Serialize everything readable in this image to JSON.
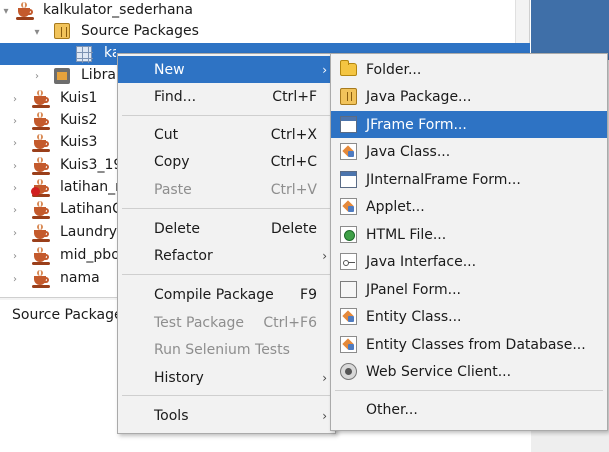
{
  "tree": {
    "items": [
      {
        "label": "kalkulator_sederhana",
        "toggle": "▾"
      },
      {
        "label": "Source Packages",
        "toggle": "▾"
      },
      {
        "label": "kalkulator_sederhana"
      },
      {
        "label": "Libraries",
        "toggle": "›"
      },
      {
        "label": "Kuis1",
        "toggle": "›"
      },
      {
        "label": "Kuis2",
        "toggle": "›"
      },
      {
        "label": "Kuis3",
        "toggle": "›"
      },
      {
        "label": "Kuis3_19",
        "toggle": "›"
      },
      {
        "label": "latihan_m",
        "toggle": "›"
      },
      {
        "label": "LatihanC",
        "toggle": "›"
      },
      {
        "label": "LaundryM",
        "toggle": "›"
      },
      {
        "label": "mid_pbo",
        "toggle": "›"
      },
      {
        "label": "nama",
        "toggle": "›"
      }
    ]
  },
  "navigator": {
    "tab_label": "Source Packages"
  },
  "context_menu": {
    "items": [
      {
        "label": "New",
        "arrow": "›"
      },
      {
        "label": "Find...",
        "shortcut": "Ctrl+F"
      },
      {
        "label": "Cut",
        "shortcut": "Ctrl+X"
      },
      {
        "label": "Copy",
        "shortcut": "Ctrl+C"
      },
      {
        "label": "Paste",
        "shortcut": "Ctrl+V"
      },
      {
        "label": "Delete",
        "shortcut": "Delete"
      },
      {
        "label": "Refactor",
        "arrow": "›"
      },
      {
        "label": "Compile Package",
        "shortcut": "F9"
      },
      {
        "label": "Test Package",
        "shortcut": "Ctrl+F6"
      },
      {
        "label": "Run Selenium Tests"
      },
      {
        "label": "History",
        "arrow": "›"
      },
      {
        "label": "Tools",
        "arrow": "›"
      }
    ]
  },
  "new_submenu": {
    "items": [
      {
        "label": "Folder...",
        "icon": "folder-icon"
      },
      {
        "label": "Java Package...",
        "icon": "java-package-icon"
      },
      {
        "label": "JFrame Form...",
        "icon": "jframe-form-icon"
      },
      {
        "label": "Java Class...",
        "icon": "java-class-icon"
      },
      {
        "label": "JInternalFrame Form...",
        "icon": "jinternalframe-form-icon"
      },
      {
        "label": "Applet...",
        "icon": "applet-icon"
      },
      {
        "label": "HTML File...",
        "icon": "html-file-icon"
      },
      {
        "label": "Java Interface...",
        "icon": "java-interface-icon"
      },
      {
        "label": "JPanel Form...",
        "icon": "jpanel-form-icon"
      },
      {
        "label": "Entity Class...",
        "icon": "entity-class-icon"
      },
      {
        "label": "Entity Classes from Database...",
        "icon": "entity-classes-db-icon"
      },
      {
        "label": "Web Service Client...",
        "icon": "web-service-client-icon"
      },
      {
        "label": "Other...",
        "icon": ""
      }
    ]
  },
  "colors": {
    "selection": "#2e73c4",
    "menu_bg": "#f2f2f2",
    "disabled_text": "#8e8e8e"
  }
}
